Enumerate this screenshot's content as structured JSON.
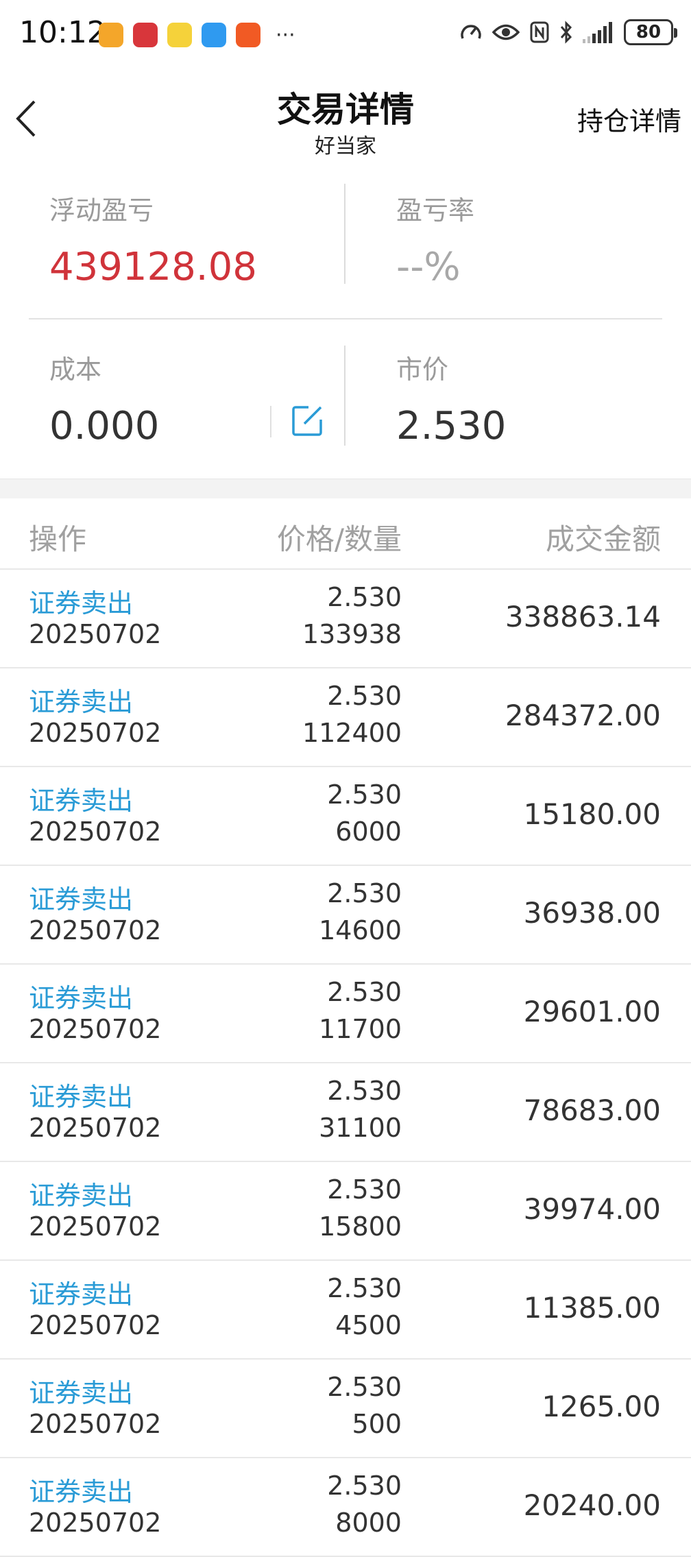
{
  "status_bar": {
    "time": "10:12",
    "more": "···",
    "battery": "80",
    "colors": {
      "app1": "#f4a62a",
      "app2": "#d8363b",
      "app3": "#f5d23a",
      "app4": "#2f9af0",
      "app5": "#f15a24"
    }
  },
  "header": {
    "title": "交易详情",
    "subtitle": "好当家",
    "right_link": "持仓详情"
  },
  "summary": {
    "floating_pl_label": "浮动盈亏",
    "floating_pl_value": "439128.08",
    "pl_rate_label": "盈亏率",
    "pl_rate_value": "--%",
    "cost_label": "成本",
    "cost_value": "0.000",
    "price_label": "市价",
    "price_value": "2.530"
  },
  "table": {
    "headers": {
      "operation": "操作",
      "price_qty": "价格/数量",
      "amount": "成交金额"
    },
    "rows": [
      {
        "op": "证券卖出",
        "date": "20250702",
        "price": "2.530",
        "qty": "133938",
        "amount": "338863.14"
      },
      {
        "op": "证券卖出",
        "date": "20250702",
        "price": "2.530",
        "qty": "112400",
        "amount": "284372.00"
      },
      {
        "op": "证券卖出",
        "date": "20250702",
        "price": "2.530",
        "qty": "6000",
        "amount": "15180.00"
      },
      {
        "op": "证券卖出",
        "date": "20250702",
        "price": "2.530",
        "qty": "14600",
        "amount": "36938.00"
      },
      {
        "op": "证券卖出",
        "date": "20250702",
        "price": "2.530",
        "qty": "11700",
        "amount": "29601.00"
      },
      {
        "op": "证券卖出",
        "date": "20250702",
        "price": "2.530",
        "qty": "31100",
        "amount": "78683.00"
      },
      {
        "op": "证券卖出",
        "date": "20250702",
        "price": "2.530",
        "qty": "15800",
        "amount": "39974.00"
      },
      {
        "op": "证券卖出",
        "date": "20250702",
        "price": "2.530",
        "qty": "4500",
        "amount": "11385.00"
      },
      {
        "op": "证券卖出",
        "date": "20250702",
        "price": "2.530",
        "qty": "500",
        "amount": "1265.00"
      },
      {
        "op": "证券卖出",
        "date": "20250702",
        "price": "2.530",
        "qty": "8000",
        "amount": "20240.00"
      }
    ]
  },
  "accent_colors": {
    "profit": "#d0333a",
    "link": "#2a9bd6",
    "label": "#9a9a9a"
  }
}
